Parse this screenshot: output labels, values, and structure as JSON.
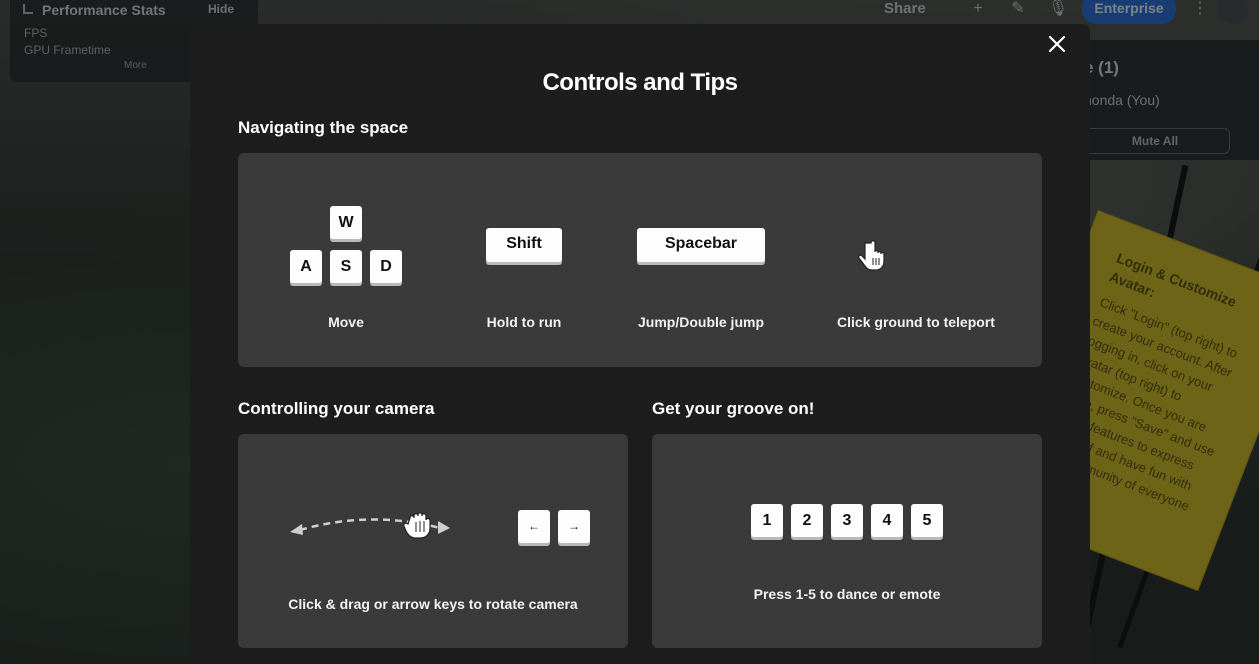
{
  "background": {
    "perf_panel": {
      "title": "Performance Stats",
      "hide_label": "Hide",
      "fps_label": "FPS",
      "gpu_label": "GPU Frametime",
      "more_label": "More"
    },
    "topbar": {
      "share_label": "Share",
      "enterprise_label": "Enterprise"
    },
    "people_panel": {
      "title": "e (1)",
      "user": "honda (You)",
      "mute_all_label": "Mute All"
    },
    "sticky_note": {
      "title": "Login & Customize Avatar:",
      "body": "Click \"Login\" (top right) to create your account. After logging in, click on your avatar (top right) to customize. Once you are done, press \"Save\" and use these features to express yourself and have fun with the community of everyone you"
    }
  },
  "modal": {
    "title": "Controls and Tips",
    "close_icon": "close-icon",
    "navigating": {
      "heading": "Navigating the space",
      "move": {
        "keys": [
          "W",
          "A",
          "S",
          "D"
        ],
        "caption": "Move"
      },
      "run": {
        "key": "Shift",
        "caption": "Hold to run"
      },
      "jump": {
        "key": "Spacebar",
        "caption": "Jump/Double jump"
      },
      "teleport": {
        "icon": "hand-pointer-icon",
        "caption": "Click ground to teleport"
      }
    },
    "camera": {
      "heading": "Controlling your camera",
      "left_key": "←",
      "right_key": "→",
      "drag_icon": "grab-hand-icon",
      "caption": "Click & drag or arrow keys to rotate camera"
    },
    "groove": {
      "heading": "Get your groove on!",
      "keys": [
        "1",
        "2",
        "3",
        "4",
        "5"
      ],
      "caption": "Press 1-5 to dance or emote"
    }
  }
}
